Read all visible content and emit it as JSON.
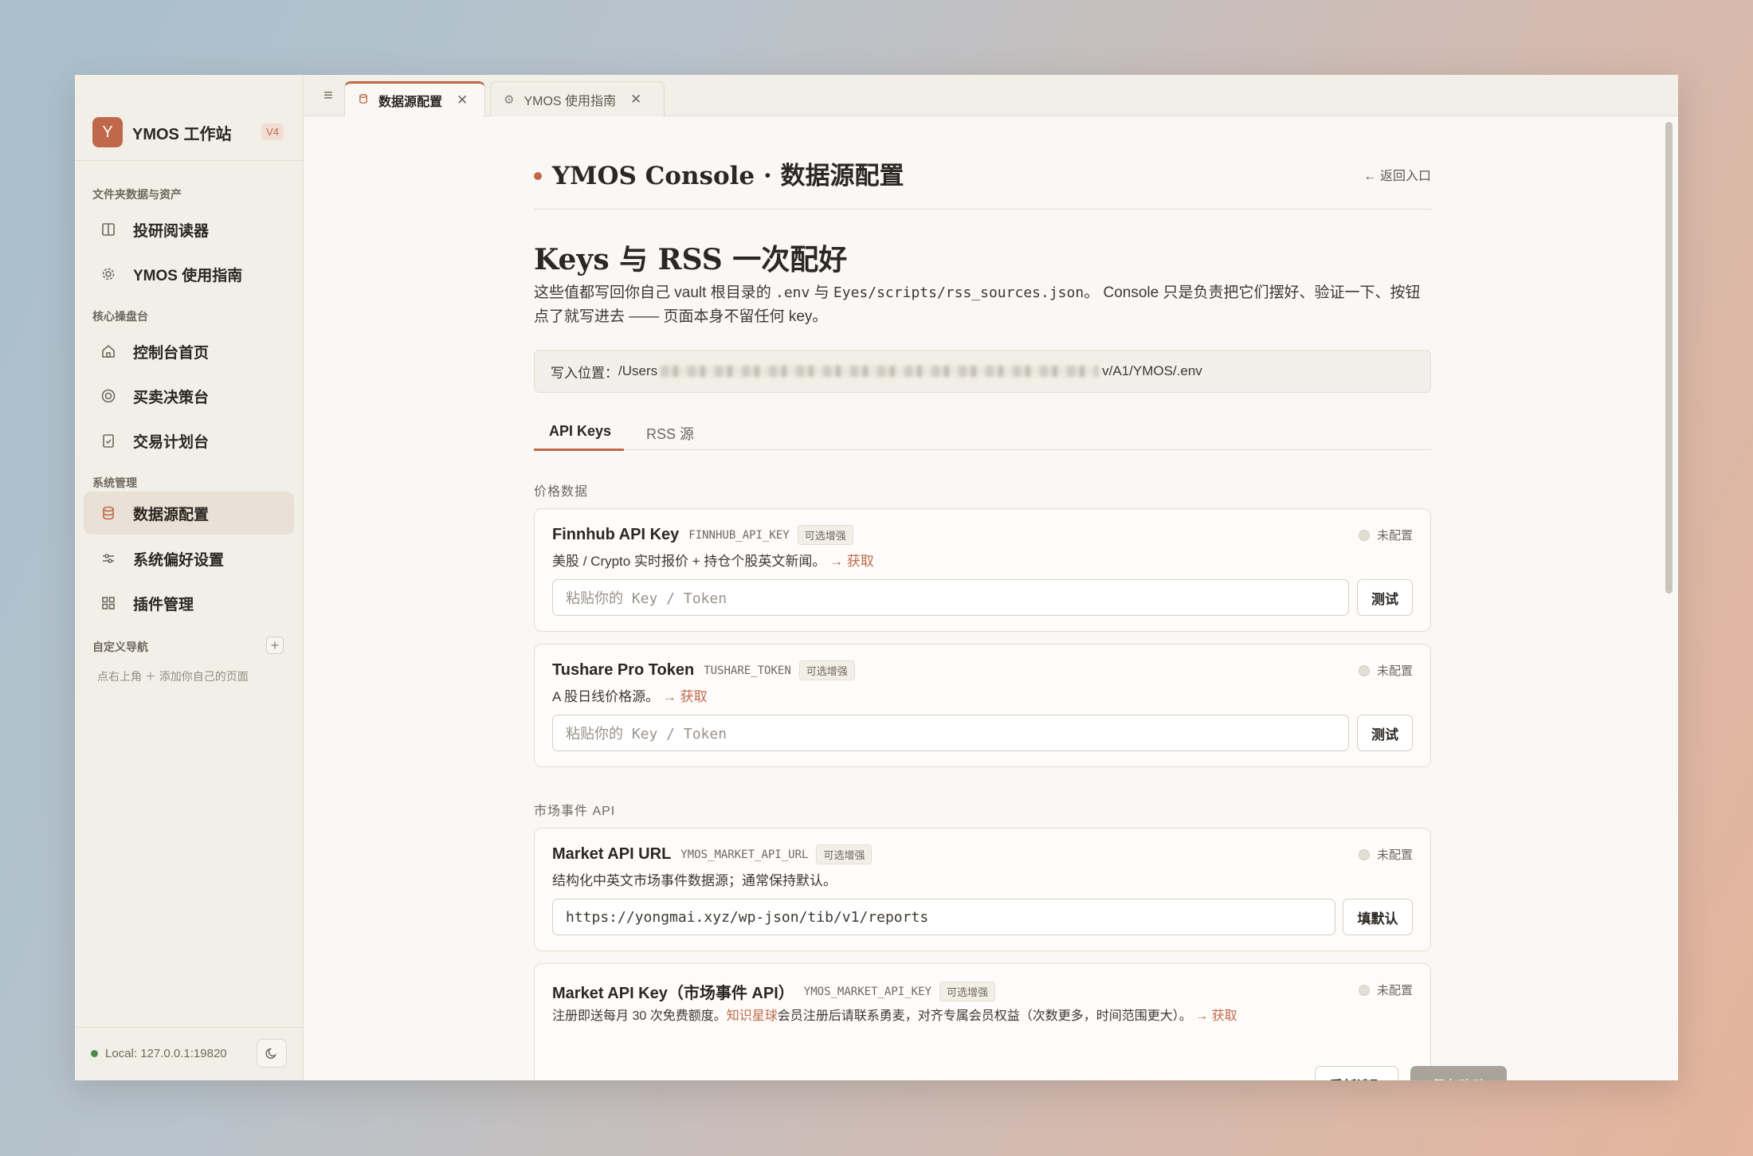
{
  "brand": {
    "logo_letter": "Y",
    "name": "YMOS 工作站",
    "version": "V4"
  },
  "sidebar": {
    "sections": [
      {
        "title": "文件夹数据与资产"
      },
      {
        "title": "核心操盘台"
      },
      {
        "title": "系统管理"
      },
      {
        "title": "自定义导航"
      }
    ],
    "items": [
      {
        "label": "投研阅读器",
        "icon": "book-icon"
      },
      {
        "label": "YMOS 使用指南",
        "icon": "gear-icon"
      },
      {
        "label": "控制台首页",
        "icon": "home-icon"
      },
      {
        "label": "买卖决策台",
        "icon": "target-icon"
      },
      {
        "label": "交易计划台",
        "icon": "clipboard-icon"
      },
      {
        "label": "数据源配置",
        "icon": "database-icon",
        "active": true
      },
      {
        "label": "系统偏好设置",
        "icon": "sliders-icon"
      },
      {
        "label": "插件管理",
        "icon": "grid-icon"
      }
    ],
    "custom_hint": "点右上角 ＋ 添加你自己的页面",
    "local_status": "Local: 127.0.0.1:19820"
  },
  "tabs": [
    {
      "label": "数据源配置",
      "active": true
    },
    {
      "label": "YMOS 使用指南",
      "active": false
    }
  ],
  "page": {
    "header_title": "YMOS Console · 数据源配置",
    "back_link": "← 返回入口",
    "heading": "Keys 与 RSS 一次配好",
    "intro_1": "这些值都写回你自己 vault 根目录的 ",
    "intro_env": ".env",
    "intro_2": " 与 ",
    "intro_rss": "Eyes/scripts/rss_sources.json",
    "intro_3": "。 Console 只是负责把它们摆好、验证一下、按钮点了就写进去 —— 页面本身不留任何 key。",
    "path_label": "写入位置：",
    "path_start": "/Users",
    "path_end": "v/A1/YMOS/.env",
    "subtabs": [
      "API Keys",
      "RSS 源"
    ]
  },
  "groups": [
    "价格数据",
    "市场事件 API"
  ],
  "cards": [
    {
      "name": "Finnhub API Key",
      "env": "FINNHUB_API_KEY",
      "tag": "可选增强",
      "status": "未配置",
      "desc": "美股 / Crypto 实时报价 + 持仓个股英文新闻。",
      "link": "→ 获取",
      "placeholder": "粘贴你的 Key / Token",
      "button": "测试"
    },
    {
      "name": "Tushare Pro Token",
      "env": "TUSHARE_TOKEN",
      "tag": "可选增强",
      "status": "未配置",
      "desc": "A 股日线价格源。",
      "link": "→ 获取",
      "placeholder": "粘贴你的 Key / Token",
      "button": "测试"
    },
    {
      "name": "Market API URL",
      "env": "YMOS_MARKET_API_URL",
      "tag": "可选增强",
      "status": "未配置",
      "desc": "结构化中英文市场事件数据源；通常保持默认。",
      "value": "https://yongmai.xyz/wp-json/tib/v1/reports",
      "button": "填默认"
    },
    {
      "name": "Market API Key（市场事件 API）",
      "env": "YMOS_MARKET_API_KEY",
      "tag": "可选增强",
      "status": "未配置",
      "desc_1": "注册即送每月 30 次免费额度。",
      "desc_link": "知识星球",
      "desc_2": "会员注册后请联系勇麦，对齐专属会员权益（次数更多，时间范围更大）。",
      "link": "→ 获取"
    }
  ],
  "footer": {
    "reload": "重新读取",
    "save": "保存改动"
  },
  "colors": {
    "accent": "#c0694a",
    "status_ok": "#4c8b4f"
  }
}
